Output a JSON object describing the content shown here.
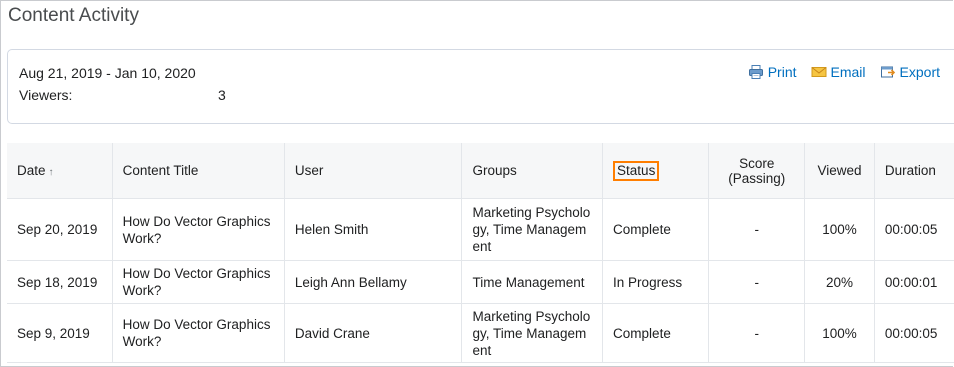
{
  "page": {
    "title": "Content Activity"
  },
  "summary": {
    "date_range": "Aug 21, 2019 - Jan 10, 2020",
    "viewers_label": "Viewers:",
    "viewers_count": "3"
  },
  "actions": {
    "print_label": "Print",
    "email_label": "Email",
    "export_label": "Export"
  },
  "table": {
    "headers": {
      "date": "Date",
      "content_title": "Content Title",
      "user": "User",
      "groups": "Groups",
      "status": "Status",
      "score": "Score (Passing)",
      "viewed": "Viewed",
      "duration": "Duration"
    },
    "rows": [
      {
        "date": "Sep 20, 2019",
        "content_title": "How Do Vector Graphics Work?",
        "user": "Helen Smith",
        "groups": "Marketing Psychology, Time Management",
        "status": "Complete",
        "score": "-",
        "viewed": "100%",
        "duration": "00:00:05"
      },
      {
        "date": "Sep 18, 2019",
        "content_title": "How Do Vector Graphics Work?",
        "user": "Leigh Ann Bellamy",
        "groups": "Time Management",
        "status": "In Progress",
        "score": "-",
        "viewed": "20%",
        "duration": "00:00:01"
      },
      {
        "date": "Sep 9, 2019",
        "content_title": "How Do Vector Graphics Work?",
        "user": "David Crane",
        "groups": "Marketing Psychology, Time Management",
        "status": "Complete",
        "score": "-",
        "viewed": "100%",
        "duration": "00:00:05"
      }
    ]
  },
  "colors": {
    "link": "#006fbf",
    "complete": "#46a661",
    "highlight": "#ff7e00"
  },
  "icons": {
    "print": "printer-icon",
    "email": "envelope-icon",
    "export": "export-icon",
    "sort": "sort-ascending-icon"
  }
}
